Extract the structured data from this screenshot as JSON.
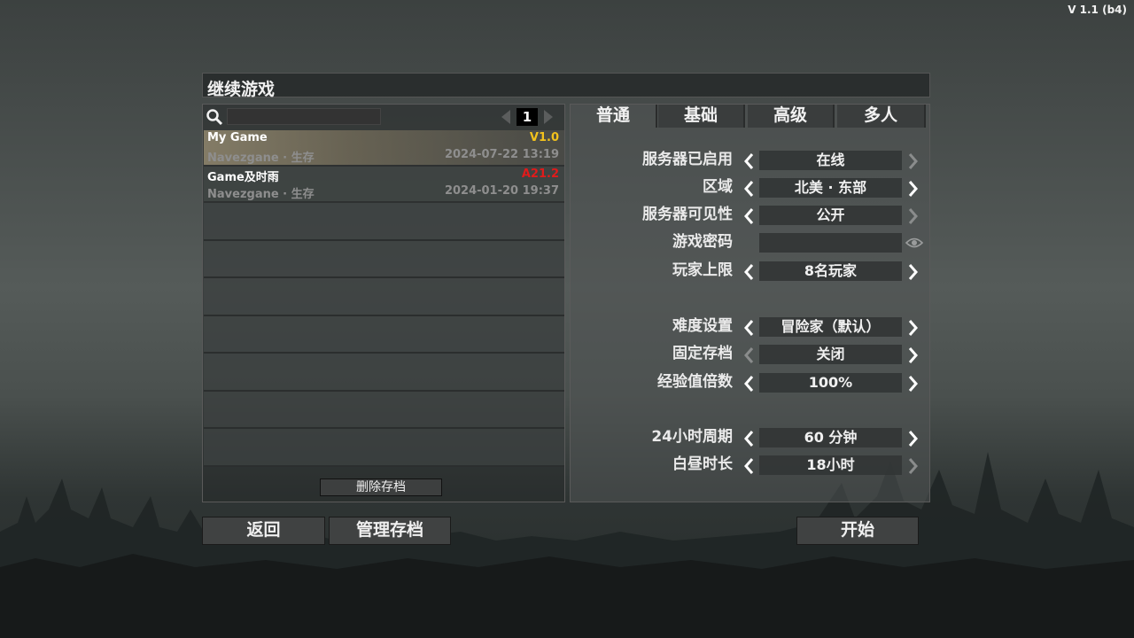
{
  "version": "V 1.1 (b4)",
  "title": "继续游戏",
  "search": {
    "value": "",
    "placeholder": ""
  },
  "pager": {
    "page": "1"
  },
  "saves": [
    {
      "name": "My Game",
      "version": "V1.0",
      "version_color": "#f3c21c",
      "world": "Navezgane · 生存",
      "date": "2024-07-22 13:19"
    },
    {
      "name": "Game及时雨",
      "version": "A21.2",
      "version_color": "#e01b1b",
      "world": "Navezgane · 生存",
      "date": "2024-01-20 19:37"
    }
  ],
  "delete_label": "删除存档",
  "tabs": [
    "普通",
    "基础",
    "高级",
    "多人"
  ],
  "settings": {
    "server_enabled": {
      "label": "服务器已启用",
      "value": "在线"
    },
    "region": {
      "label": "区域",
      "value": "北美 · 东部"
    },
    "visibility": {
      "label": "服务器可见性",
      "value": "公开"
    },
    "password": {
      "label": "游戏密码",
      "value": ""
    },
    "max_players": {
      "label": "玩家上限",
      "value": "8名玩家"
    },
    "difficulty": {
      "label": "难度设置",
      "value": "冒险家（默认）"
    },
    "fixed_save": {
      "label": "固定存档",
      "value": "关闭"
    },
    "xp_multiplier": {
      "label": "经验值倍数",
      "value": "100%"
    },
    "day_cycle": {
      "label": "24小时周期",
      "value": "60 分钟"
    },
    "daylight": {
      "label": "白昼时长",
      "value": "18小时"
    }
  },
  "buttons": {
    "back": "返回",
    "manage": "管理存档",
    "start": "开始"
  },
  "colors": {
    "accent_yellow": "#f3c21c",
    "accent_red": "#e01b1b",
    "arrow_active": "#ffffff",
    "arrow_disabled": "#8a8c8c"
  }
}
